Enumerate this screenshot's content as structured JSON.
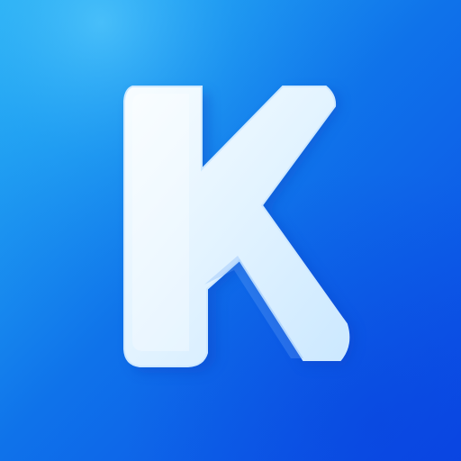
{
  "icon": {
    "name": "k-logo-icon",
    "letter": "K",
    "colors": {
      "background_top": "#1fa2f4",
      "background_mid": "#0f73ea",
      "background_bottom": "#0b49e6",
      "letter_fill": "#dff1ff",
      "letter_highlight": "#f8fdff",
      "letter_shadow": "#0a3fc3"
    }
  }
}
